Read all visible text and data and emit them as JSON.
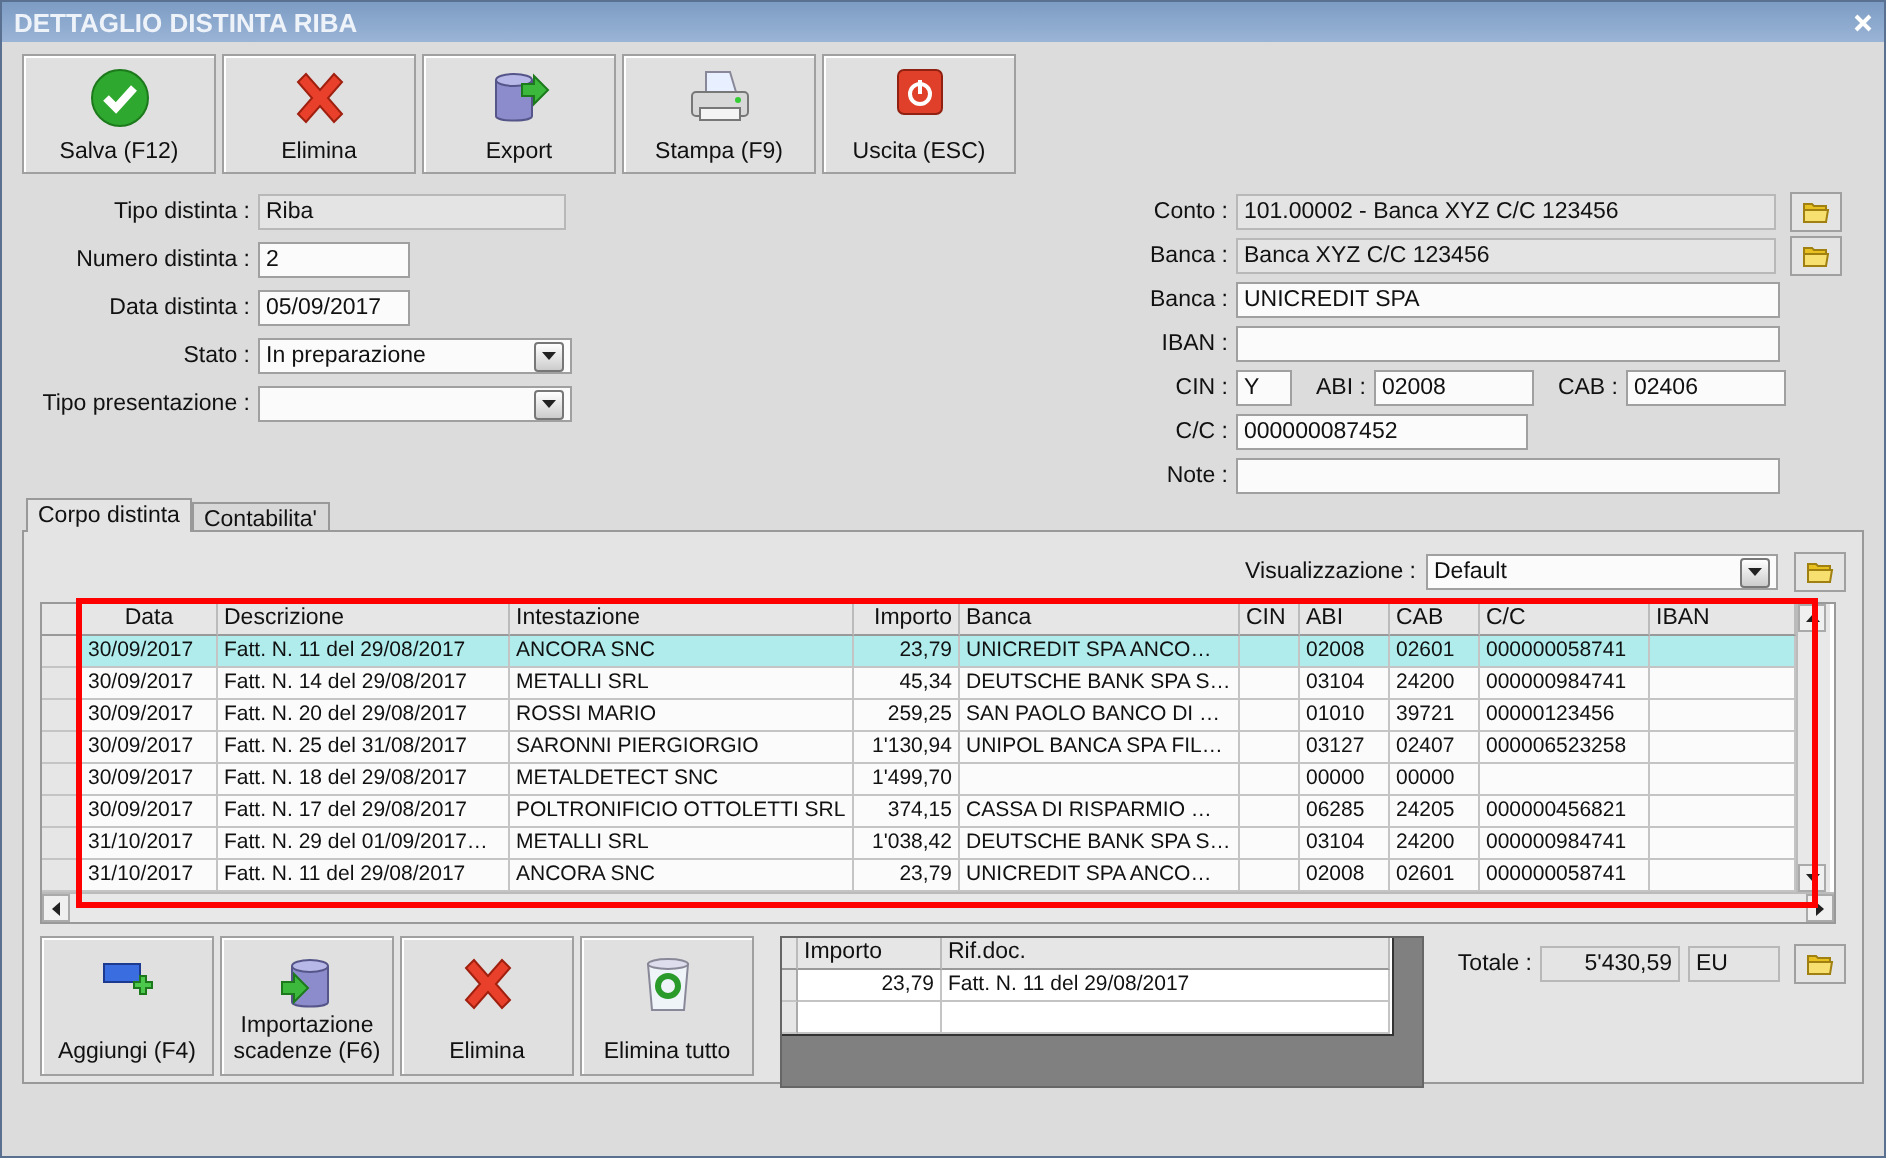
{
  "window": {
    "title": "DETTAGLIO DISTINTA RIBA"
  },
  "toolbar": [
    {
      "label": "Salva (F12)",
      "kind": "save"
    },
    {
      "label": "Elimina",
      "kind": "delete"
    },
    {
      "label": "Export",
      "kind": "export"
    },
    {
      "label": "Stampa (F9)",
      "kind": "print"
    },
    {
      "label": "Uscita (ESC)",
      "kind": "exit"
    }
  ],
  "form_left": [
    {
      "label": "Tipo distinta :",
      "value": "Riba",
      "kind": "readonly"
    },
    {
      "label": "Numero distinta :",
      "value": "2",
      "kind": "input"
    },
    {
      "label": "Data distinta :",
      "value": "05/09/2017",
      "kind": "input"
    },
    {
      "label": "Stato :",
      "value": "In preparazione",
      "kind": "select"
    },
    {
      "label": "Tipo presentazione :",
      "kind": "select"
    }
  ],
  "form_right": [
    {
      "fields": [
        {
          "label": "Conto :",
          "value": "101.00002 - Banca XYZ C/C 123456",
          "kind": "readonly",
          "lookup": true
        }
      ]
    },
    {
      "fields": [
        {
          "label": "Banca :",
          "value": "Banca XYZ C/C 123456",
          "kind": "readonly",
          "lookup": true
        }
      ]
    },
    {
      "fields": [
        {
          "label": "Banca :",
          "value": "UNICREDIT SPA",
          "kind": "input"
        }
      ]
    },
    {
      "fields": [
        {
          "label": "IBAN :",
          "kind": "input"
        }
      ]
    },
    {
      "fields": [
        {
          "label": "CIN :",
          "value": "Y",
          "kind": "tiny"
        },
        {
          "label": "ABI :",
          "value": "02008",
          "kind": "medium"
        },
        {
          "label": "CAB :",
          "value": "02406",
          "kind": "medium"
        }
      ]
    },
    {
      "fields": [
        {
          "label": "C/C :",
          "value": "000000087452",
          "kind": "short"
        }
      ]
    },
    {
      "fields": [
        {
          "label": "Note :",
          "kind": "input"
        }
      ]
    }
  ],
  "tabs": [
    {
      "label": "Corpo distinta",
      "selected": true
    },
    {
      "label": "Contabilita'",
      "selected": false
    }
  ],
  "view": {
    "label": "Visualizzazione :",
    "value": "Default"
  },
  "table": {
    "columns": [
      "Data",
      "Descrizione",
      "Intestazione",
      "Importo",
      "Banca",
      "CIN",
      "ABI",
      "CAB",
      "C/C",
      "IBAN"
    ],
    "rows": [
      {
        "selected": true,
        "cells": [
          "30/09/2017",
          "Fatt. N. 11 del 29/08/2017",
          "ANCORA SNC",
          "23,79",
          "UNICREDIT SPA ANCO…",
          "",
          "02008",
          "02601",
          "000000058741",
          ""
        ]
      },
      {
        "selected": false,
        "cells": [
          "30/09/2017",
          "Fatt. N. 14 del 29/08/2017",
          "METALLI SRL",
          "45,34",
          "DEUTSCHE BANK SPA S…",
          "",
          "03104",
          "24200",
          "000000984741",
          ""
        ]
      },
      {
        "selected": false,
        "cells": [
          "30/09/2017",
          "Fatt. N. 20 del 29/08/2017",
          "ROSSI MARIO",
          "259,25",
          "SAN PAOLO BANCO DI …",
          "",
          "01010",
          "39721",
          "00000123456",
          ""
        ]
      },
      {
        "selected": false,
        "cells": [
          "30/09/2017",
          "Fatt. N. 25 del 31/08/2017",
          "SARONNI PIERGIORGIO",
          "1'130,94",
          "UNIPOL BANCA SPA FIL…",
          "",
          "03127",
          "02407",
          "000006523258",
          ""
        ]
      },
      {
        "selected": false,
        "cells": [
          "30/09/2017",
          "Fatt. N. 18 del 29/08/2017",
          "METALDETECT SNC",
          "1'499,70",
          "",
          "",
          "00000",
          "00000",
          "",
          ""
        ]
      },
      {
        "selected": false,
        "cells": [
          "30/09/2017",
          "Fatt. N. 17 del 29/08/2017",
          "POLTRONIFICIO OTTOLETTI SRL",
          "374,15",
          "CASSA DI RISPARMIO …",
          "",
          "06285",
          "24205",
          "000000456821",
          ""
        ]
      },
      {
        "selected": false,
        "cells": [
          "31/10/2017",
          "Fatt. N. 29 del 01/09/2017…",
          "METALLI SRL",
          "1'038,42",
          "DEUTSCHE BANK SPA S…",
          "",
          "03104",
          "24200",
          "000000984741",
          ""
        ]
      },
      {
        "selected": false,
        "cells": [
          "31/10/2017",
          "Fatt. N. 11 del 29/08/2017",
          "ANCORA SNC",
          "23,79",
          "UNICREDIT SPA ANCO…",
          "",
          "02008",
          "02601",
          "000000058741",
          ""
        ]
      }
    ]
  },
  "bottom_buttons": [
    {
      "label": "Aggiungi (F4)",
      "kind": "add"
    },
    {
      "label": "Importazione scadenze (F6)",
      "kind": "import"
    },
    {
      "label": "Elimina",
      "kind": "delete"
    },
    {
      "label": "Elimina tutto",
      "kind": "clear"
    }
  ],
  "detail_table": {
    "columns": [
      "Importo",
      "Rif.doc."
    ],
    "rows": [
      [
        "23,79",
        "Fatt. N. 11 del 29/08/2017"
      ]
    ]
  },
  "total": {
    "label": "Totale :",
    "value": "5'430,59",
    "currency": "EU"
  }
}
